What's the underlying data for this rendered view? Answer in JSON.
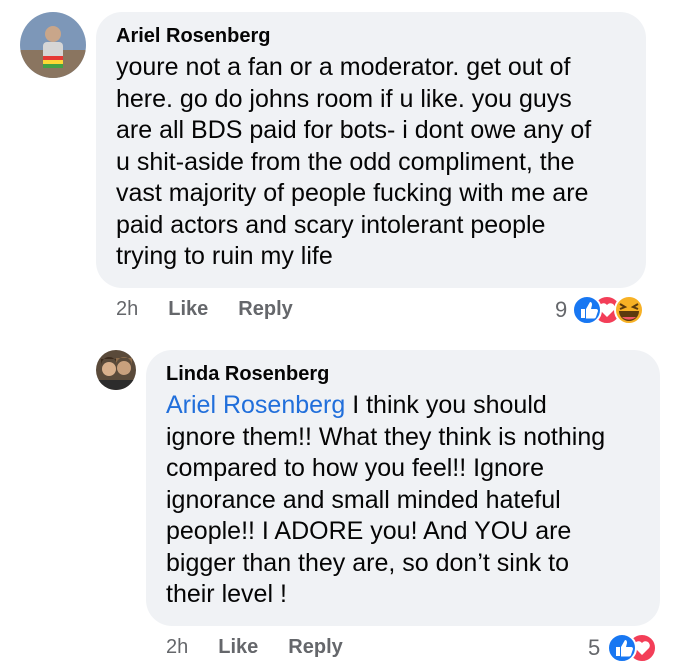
{
  "comments": [
    {
      "author": "Ariel Rosenberg",
      "text": "youre not a fan or a moderator. get out of\nhere. go do johns room if u like. you guys\nare all BDS paid for bots- i dont owe any of\nu shit-aside from the odd compliment, the\nvast majority of people fucking with me are\npaid actors and scary intolerant people\ntrying to ruin my life",
      "time": "2h",
      "like_label": "Like",
      "reply_label": "Reply",
      "reaction_count": "9",
      "reactions": [
        "like-reaction-icon",
        "love-reaction-icon",
        "haha-reaction-icon"
      ]
    },
    {
      "author": "Linda Rosenberg",
      "mention": "Ariel Rosenberg",
      "text": " I think you should\nignore them!! What they think is nothing\ncompared to how you feel!! Ignore\nignorance and small minded hateful\npeople!! I ADORE you! And YOU are\nbigger than they are, so don’t sink to\ntheir level !",
      "time": "2h",
      "like_label": "Like",
      "reply_label": "Reply",
      "reaction_count": "5",
      "reactions": [
        "like-reaction-icon",
        "love-reaction-icon"
      ]
    }
  ],
  "colors": {
    "bubble": "#f0f2f5",
    "mention": "#216fdb",
    "meta": "#65676b",
    "like": "#1877f2",
    "love": "#f33e58",
    "haha": "#f7b125"
  }
}
